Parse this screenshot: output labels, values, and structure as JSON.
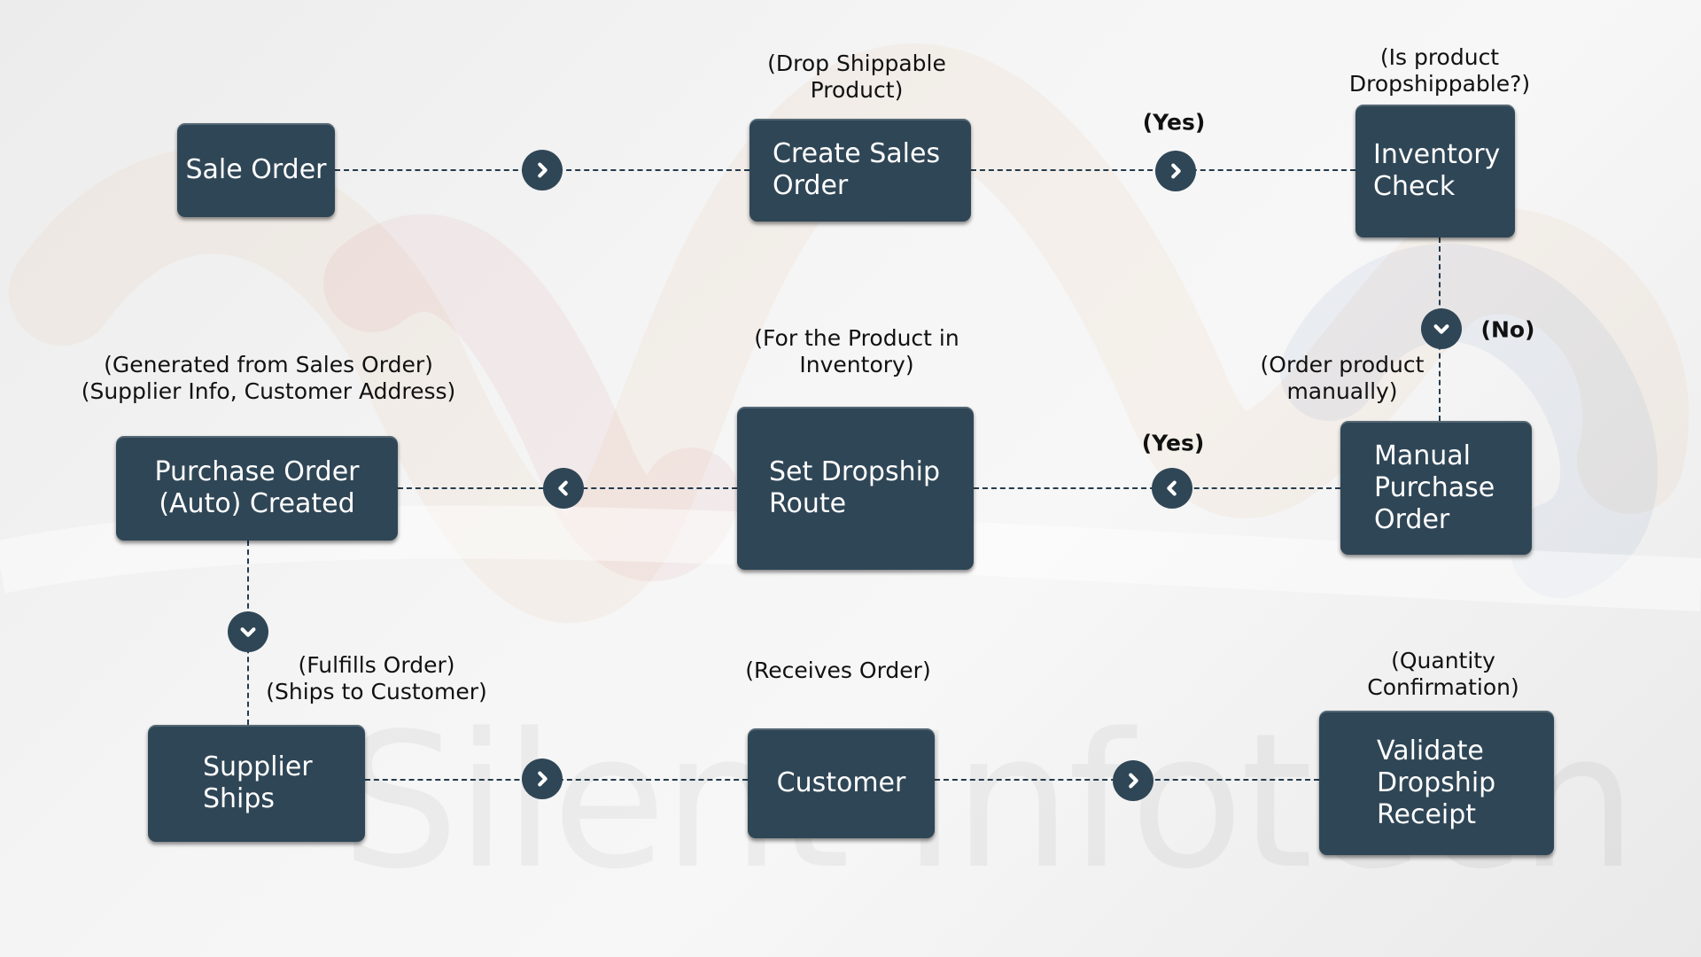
{
  "diagram": {
    "watermark": "Silent Infotech",
    "nodes": {
      "sale_order": "Sale Order",
      "create_sales_order": "Create Sales\nOrder",
      "inventory_check": "Inventory\nCheck",
      "manual_purchase_order": "Manual\nPurchase\nOrder",
      "set_dropship_route": "Set Dropship\nRoute",
      "purchase_order_auto": "Purchase Order\n(Auto) Created",
      "supplier_ships": "Supplier\nShips",
      "customer": "Customer",
      "validate_receipt": "Validate\nDropship\nReceipt"
    },
    "notes": {
      "drop_shippable": "(Drop Shippable\nProduct)",
      "is_dropshippable": "(Is product\nDropshippable?)",
      "order_manually": "(Order product\nmanually)",
      "for_product_inventory": "(For the Product in\nInventory)",
      "generated_from": "(Generated from Sales Order)\n(Supplier Info, Customer Address)",
      "fulfills": "(Fulfills Order)\n(Ships to Customer)",
      "receives": "(Receives Order)",
      "quantity_confirmation": "(Quantity Confirmation)"
    },
    "tags": {
      "yes_top": "(Yes)",
      "no": "(No)",
      "yes_middle": "(Yes)"
    },
    "colors": {
      "box": "#2f4656",
      "connector": "#243b4d",
      "text_on_box": "#ffffff"
    },
    "connectors": [
      {
        "from": "Sale Order",
        "to": "Create Sales Order",
        "direction": "right"
      },
      {
        "from": "Create Sales Order",
        "to": "Inventory Check",
        "direction": "right",
        "label": "(Yes)"
      },
      {
        "from": "Inventory Check",
        "to": "Manual Purchase Order",
        "direction": "down",
        "label": "(No)"
      },
      {
        "from": "Manual Purchase Order",
        "to": "Set Dropship Route",
        "direction": "left",
        "label": "(Yes)"
      },
      {
        "from": "Set Dropship Route",
        "to": "Purchase Order (Auto) Created",
        "direction": "left"
      },
      {
        "from": "Purchase Order (Auto) Created",
        "to": "Supplier Ships",
        "direction": "down"
      },
      {
        "from": "Supplier Ships",
        "to": "Customer",
        "direction": "right"
      },
      {
        "from": "Customer",
        "to": "Validate Dropship Receipt",
        "direction": "right"
      }
    ]
  }
}
